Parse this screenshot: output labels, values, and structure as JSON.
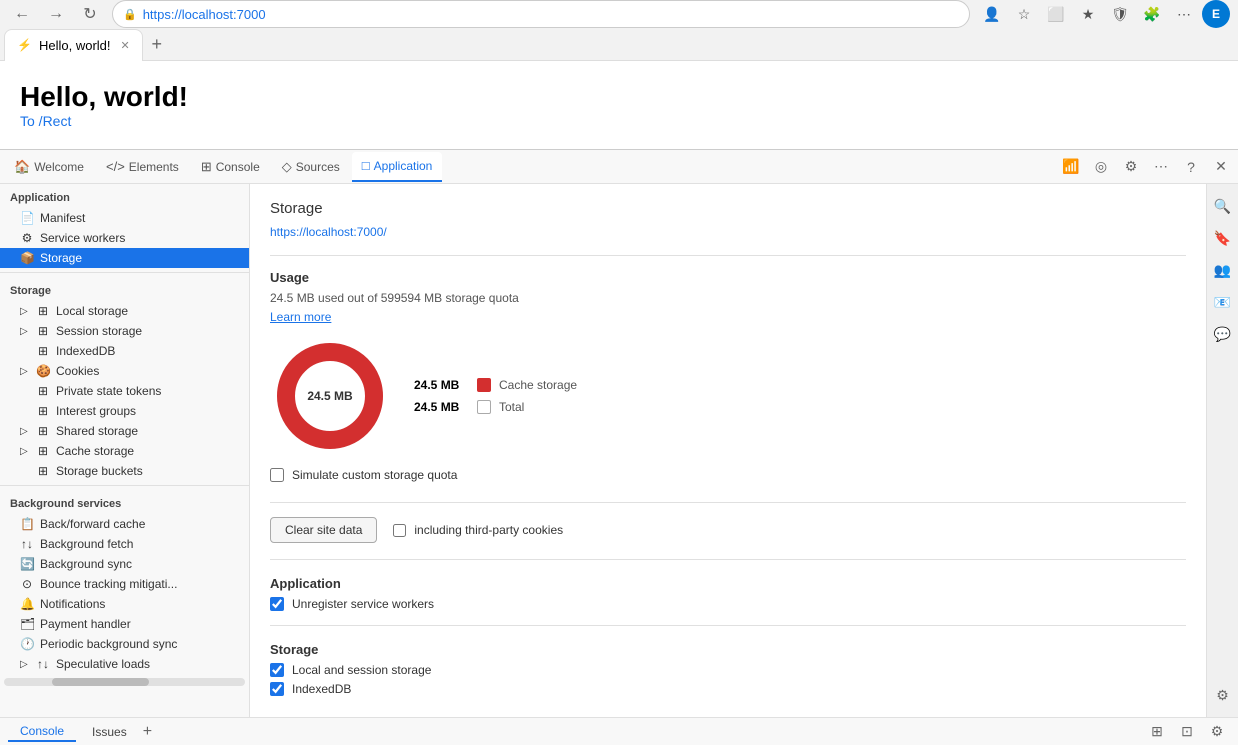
{
  "browser": {
    "url": "https://localhost:7000",
    "url_display": "https://localhost:7000",
    "tab_title": "Hello, world!",
    "favicon": "⚡"
  },
  "devtools_tabs": [
    {
      "id": "welcome",
      "label": "Welcome",
      "icon": "🏠",
      "active": false
    },
    {
      "id": "elements",
      "label": "Elements",
      "icon": "</>",
      "active": false
    },
    {
      "id": "console",
      "label": "Console",
      "icon": ">_",
      "active": false
    },
    {
      "id": "sources",
      "label": "Sources",
      "icon": "◇",
      "active": false
    },
    {
      "id": "application",
      "label": "Application",
      "icon": "□",
      "active": true
    }
  ],
  "sidebar": {
    "application_header": "Application",
    "items_application": [
      {
        "id": "manifest",
        "label": "Manifest",
        "icon": "📄",
        "indent": 1
      },
      {
        "id": "service-workers",
        "label": "Service workers",
        "icon": "⚙",
        "indent": 1
      },
      {
        "id": "storage-item",
        "label": "Storage",
        "icon": "📦",
        "indent": 1,
        "active": true
      }
    ],
    "storage_header": "Storage",
    "items_storage": [
      {
        "id": "local-storage",
        "label": "Local storage",
        "icon": "▷",
        "hasArrow": true
      },
      {
        "id": "session-storage",
        "label": "Session storage",
        "icon": "▷",
        "hasArrow": true
      },
      {
        "id": "indexed-db",
        "label": "IndexedDB",
        "icon": "",
        "hasArrow": false
      },
      {
        "id": "cookies",
        "label": "Cookies",
        "icon": "▷",
        "hasArrow": true
      },
      {
        "id": "private-state-tokens",
        "label": "Private state tokens",
        "icon": "",
        "hasArrow": false
      },
      {
        "id": "interest-groups",
        "label": "Interest groups",
        "icon": "",
        "hasArrow": false
      },
      {
        "id": "shared-storage",
        "label": "Shared storage",
        "icon": "▷",
        "hasArrow": true
      },
      {
        "id": "cache-storage",
        "label": "Cache storage",
        "icon": "▷",
        "hasArrow": true
      },
      {
        "id": "storage-buckets",
        "label": "Storage buckets",
        "icon": "",
        "hasArrow": false
      }
    ],
    "background_header": "Background services",
    "items_background": [
      {
        "id": "back-forward",
        "label": "Back/forward cache",
        "icon": "📋"
      },
      {
        "id": "bg-fetch",
        "label": "Background fetch",
        "icon": "↑↓"
      },
      {
        "id": "bg-sync",
        "label": "Background sync",
        "icon": "🔄"
      },
      {
        "id": "bounce-tracking",
        "label": "Bounce tracking mitigati...",
        "icon": "⊙"
      },
      {
        "id": "notifications",
        "label": "Notifications",
        "icon": "🔔"
      },
      {
        "id": "payment-handler",
        "label": "Payment handler",
        "icon": "🗂"
      },
      {
        "id": "periodic-bg-sync",
        "label": "Periodic background sync",
        "icon": "🕐"
      },
      {
        "id": "speculative-loads",
        "label": "Speculative loads",
        "icon": "▷"
      }
    ]
  },
  "main": {
    "title": "Storage",
    "url": "https://localhost:7000/",
    "usage_title": "Usage",
    "usage_text": "24.5 MB used out of 599594 MB storage quota",
    "learn_more": "Learn more",
    "chart_center_label": "24.5 MB",
    "legend": [
      {
        "value": "24.5 MB",
        "name": "Cache storage",
        "color": "#d32f2f",
        "empty": false
      },
      {
        "value": "24.5 MB",
        "name": "Total",
        "color": "",
        "empty": true
      }
    ],
    "simulate_checkbox_label": "Simulate custom storage quota",
    "simulate_checked": false,
    "clear_button": "Clear site data",
    "including_checkbox_label": "including third-party cookies",
    "including_checked": false,
    "application_section_title": "Application",
    "unregister_label": "Unregister service workers",
    "unregister_checked": true,
    "storage_section_title": "Storage",
    "local_session_label": "Local and session storage",
    "local_session_checked": true,
    "indexeddb_label": "IndexedDB",
    "indexeddb_checked": true
  },
  "bottom_bar": {
    "tabs": [
      {
        "id": "console",
        "label": "Console",
        "active": false
      },
      {
        "id": "issues",
        "label": "Issues",
        "active": false
      }
    ]
  },
  "webpage": {
    "heading": "Hello, world!",
    "link_text": "To /Rect",
    "link_href": "#"
  }
}
